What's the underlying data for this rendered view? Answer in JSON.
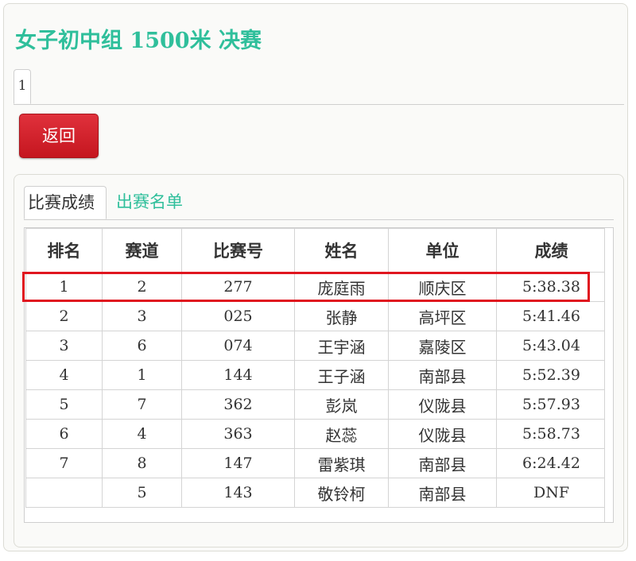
{
  "title_cn_prefix": "女子初中组 ",
  "title_number": "1500",
  "title_cn_suffix": "米 决赛",
  "page_tab": "1",
  "back_button": "返回",
  "inner_tabs": {
    "active": "比赛成绩",
    "other": "出赛名单"
  },
  "table": {
    "headers": [
      "排名",
      "赛道",
      "比赛号",
      "姓名",
      "单位",
      "成绩"
    ],
    "rows": [
      [
        "1",
        "2",
        "277",
        "庞庭雨",
        "顺庆区",
        "5:38.38"
      ],
      [
        "2",
        "3",
        "025",
        "张静",
        "高坪区",
        "5:41.46"
      ],
      [
        "3",
        "6",
        "074",
        "王宇涵",
        "嘉陵区",
        "5:43.04"
      ],
      [
        "4",
        "1",
        "144",
        "王子涵",
        "南部县",
        "5:52.39"
      ],
      [
        "5",
        "7",
        "362",
        "彭岚",
        "仪陇县",
        "5:57.93"
      ],
      [
        "6",
        "4",
        "363",
        "赵蕊",
        "仪陇县",
        "5:58.73"
      ],
      [
        "7",
        "8",
        "147",
        "雷紫琪",
        "南部县",
        "6:24.42"
      ],
      [
        "",
        "5",
        "143",
        "敬铃柯",
        "南部县",
        "DNF"
      ]
    ]
  },
  "highlight_color": "#e0161f",
  "accent_color": "#2fbf9b",
  "button_color": "#d11f28"
}
